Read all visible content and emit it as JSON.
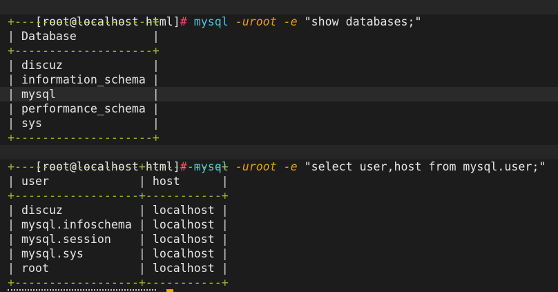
{
  "colors": {
    "background": "#1c1c1c",
    "prompt_band": "#262626",
    "highlight_row": "#2a2a2a",
    "table_border": "#9ab82c",
    "command": "#4fc3dc",
    "option": "#e0a010",
    "prompt_hash": "#ff4466",
    "cursor": "#f0a800"
  },
  "session": {
    "command1": {
      "prompt": "[root@localhost html]",
      "hash": "#",
      "program": "mysql",
      "opt_user": "-uroot",
      "opt_exec": "-e",
      "argument": "\"show databases;\""
    },
    "table1": {
      "border": "+--------------------+",
      "header": "Database",
      "rows": [
        "discuz",
        "information_schema",
        "mysql",
        "performance_schema",
        "sys"
      ],
      "highlighted_row": 2
    },
    "command2": {
      "prompt": "[root@localhost html]",
      "hash": "#",
      "program": "mysql",
      "opt_user": "-uroot",
      "opt_exec": "-e",
      "argument": "\"select user,host from mysql.user;\""
    },
    "table2": {
      "border": "+------------------+-----------+",
      "headers": [
        "user",
        "host"
      ],
      "rows": [
        [
          "discuz",
          "localhost"
        ],
        [
          "mysql.infoschema",
          "localhost"
        ],
        [
          "mysql.session",
          "localhost"
        ],
        [
          "mysql.sys",
          "localhost"
        ],
        [
          "root",
          "localhost"
        ]
      ]
    }
  }
}
